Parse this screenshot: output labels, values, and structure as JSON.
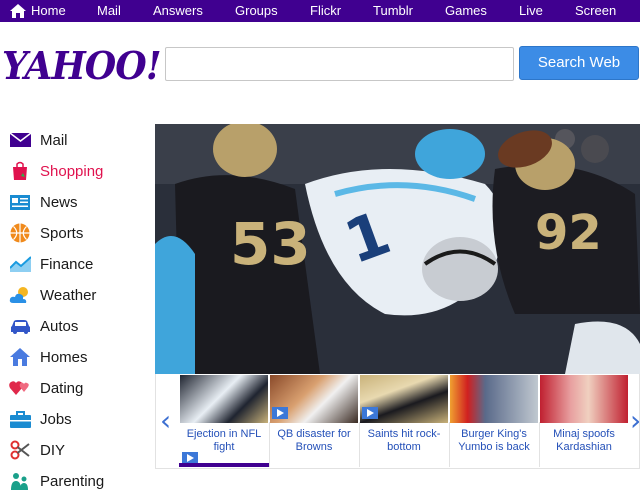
{
  "topnav": {
    "items": [
      {
        "label": "Home",
        "icon": "home-icon"
      },
      {
        "label": "Mail"
      },
      {
        "label": "Answers"
      },
      {
        "label": "Groups"
      },
      {
        "label": "Flickr"
      },
      {
        "label": "Tumblr"
      },
      {
        "label": "Games"
      },
      {
        "label": "Live"
      },
      {
        "label": "Screen"
      }
    ],
    "background": "#400090"
  },
  "logo": {
    "text": "YAHOO!"
  },
  "search": {
    "placeholder": "",
    "value": "",
    "button_label": "Search Web",
    "button_color": "#3c8ce6"
  },
  "sidebar": {
    "items": [
      {
        "label": "Mail",
        "icon": "envelope-icon",
        "color": "#400090"
      },
      {
        "label": "Shopping",
        "icon": "shopping-bag-icon",
        "color": "#e0124e",
        "active": true
      },
      {
        "label": "News",
        "icon": "newspaper-icon",
        "color": "#1a8bd1"
      },
      {
        "label": "Sports",
        "icon": "basketball-icon",
        "color": "#f08a1c"
      },
      {
        "label": "Finance",
        "icon": "chart-icon",
        "color": "#1a9be0"
      },
      {
        "label": "Weather",
        "icon": "weather-icon",
        "color": "#2a90e6"
      },
      {
        "label": "Autos",
        "icon": "car-icon",
        "color": "#3256c8"
      },
      {
        "label": "Homes",
        "icon": "house-icon",
        "color": "#4a7be0"
      },
      {
        "label": "Dating",
        "icon": "hearts-icon",
        "color": "#e0284a"
      },
      {
        "label": "Jobs",
        "icon": "briefcase-icon",
        "color": "#1a8bd1"
      },
      {
        "label": "DIY",
        "icon": "scissors-icon",
        "color": "#e03030"
      },
      {
        "label": "Parenting",
        "icon": "parenting-icon",
        "color": "#1aa08a"
      }
    ]
  },
  "hero": {
    "subject": "football-players-photo"
  },
  "carousel": {
    "items": [
      {
        "caption": "Ejection in NFL fight",
        "video": true,
        "active": true
      },
      {
        "caption": "QB disaster for Browns",
        "video": true
      },
      {
        "caption": "Saints hit rock-bottom",
        "video": true
      },
      {
        "caption": "Burger King's Yumbo is back",
        "video": false
      },
      {
        "caption": "Minaj spoofs Kardashian",
        "video": false
      }
    ]
  }
}
